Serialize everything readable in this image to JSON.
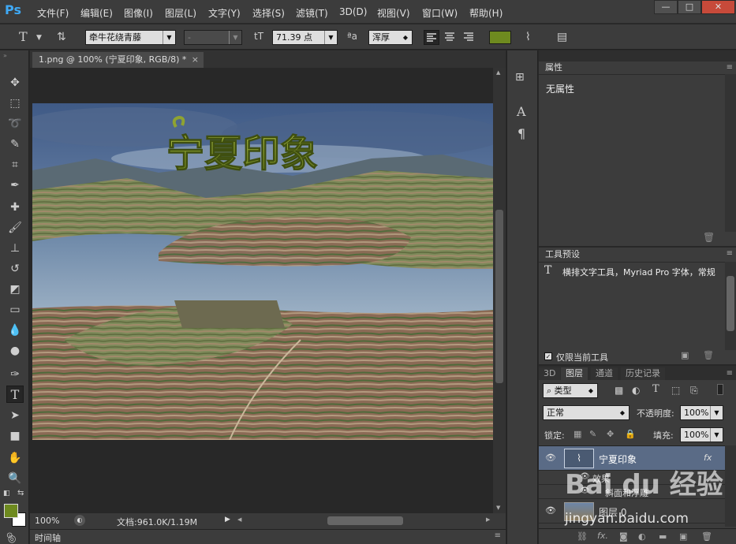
{
  "app": {
    "logo": "Ps"
  },
  "menu": [
    "文件(F)",
    "编辑(E)",
    "图像(I)",
    "图层(L)",
    "文字(Y)",
    "选择(S)",
    "滤镜(T)",
    "3D(D)",
    "视图(V)",
    "窗口(W)",
    "帮助(H)"
  ],
  "window_controls": {
    "minimize": "—",
    "maximize": "□",
    "close": "✕"
  },
  "options": {
    "tool_glyph": "T",
    "font_family": "牵牛花绕青藤",
    "font_style": "-",
    "font_size": "71.39 点",
    "aa_label": "ªa",
    "antialias": "浑厚",
    "text_color": "#6e8a1f"
  },
  "document": {
    "tab_title": "1.png @ 100% (宁夏印象, RGB/8) *",
    "tab_close": "×",
    "image_title": "宁夏印象"
  },
  "status": {
    "zoom": "100%",
    "doc_info": "文档:961.0K/1.19M"
  },
  "timeline": {
    "label": "时间轴"
  },
  "properties": {
    "tab": "属性",
    "content": "无属性"
  },
  "tool_presets": {
    "tab": "工具预设",
    "item": "横排文字工具，Myriad Pro 字体，常规",
    "checkbox_label": "仅限当前工具"
  },
  "layers_panel": {
    "tabs": [
      "3D",
      "图层",
      "通道",
      "历史记录"
    ],
    "filter_kind": "类型",
    "blend_mode": "正常",
    "opacity_label": "不透明度:",
    "opacity_value": "100%",
    "lock_label": "锁定:",
    "fill_label": "填充:",
    "fill_value": "100%",
    "layers": [
      {
        "name": "宁夏印象",
        "fx": "fx",
        "effects_label": "效果",
        "effect_item": "斜面和浮雕"
      },
      {
        "name": "图层 0"
      }
    ]
  },
  "colors": {
    "foreground": "#6e8a1f",
    "background": "#ffffff",
    "accent": "#3fa9f5"
  },
  "watermark": {
    "brand": "Bai du 经验",
    "url": "jingyan.baidu.com"
  }
}
